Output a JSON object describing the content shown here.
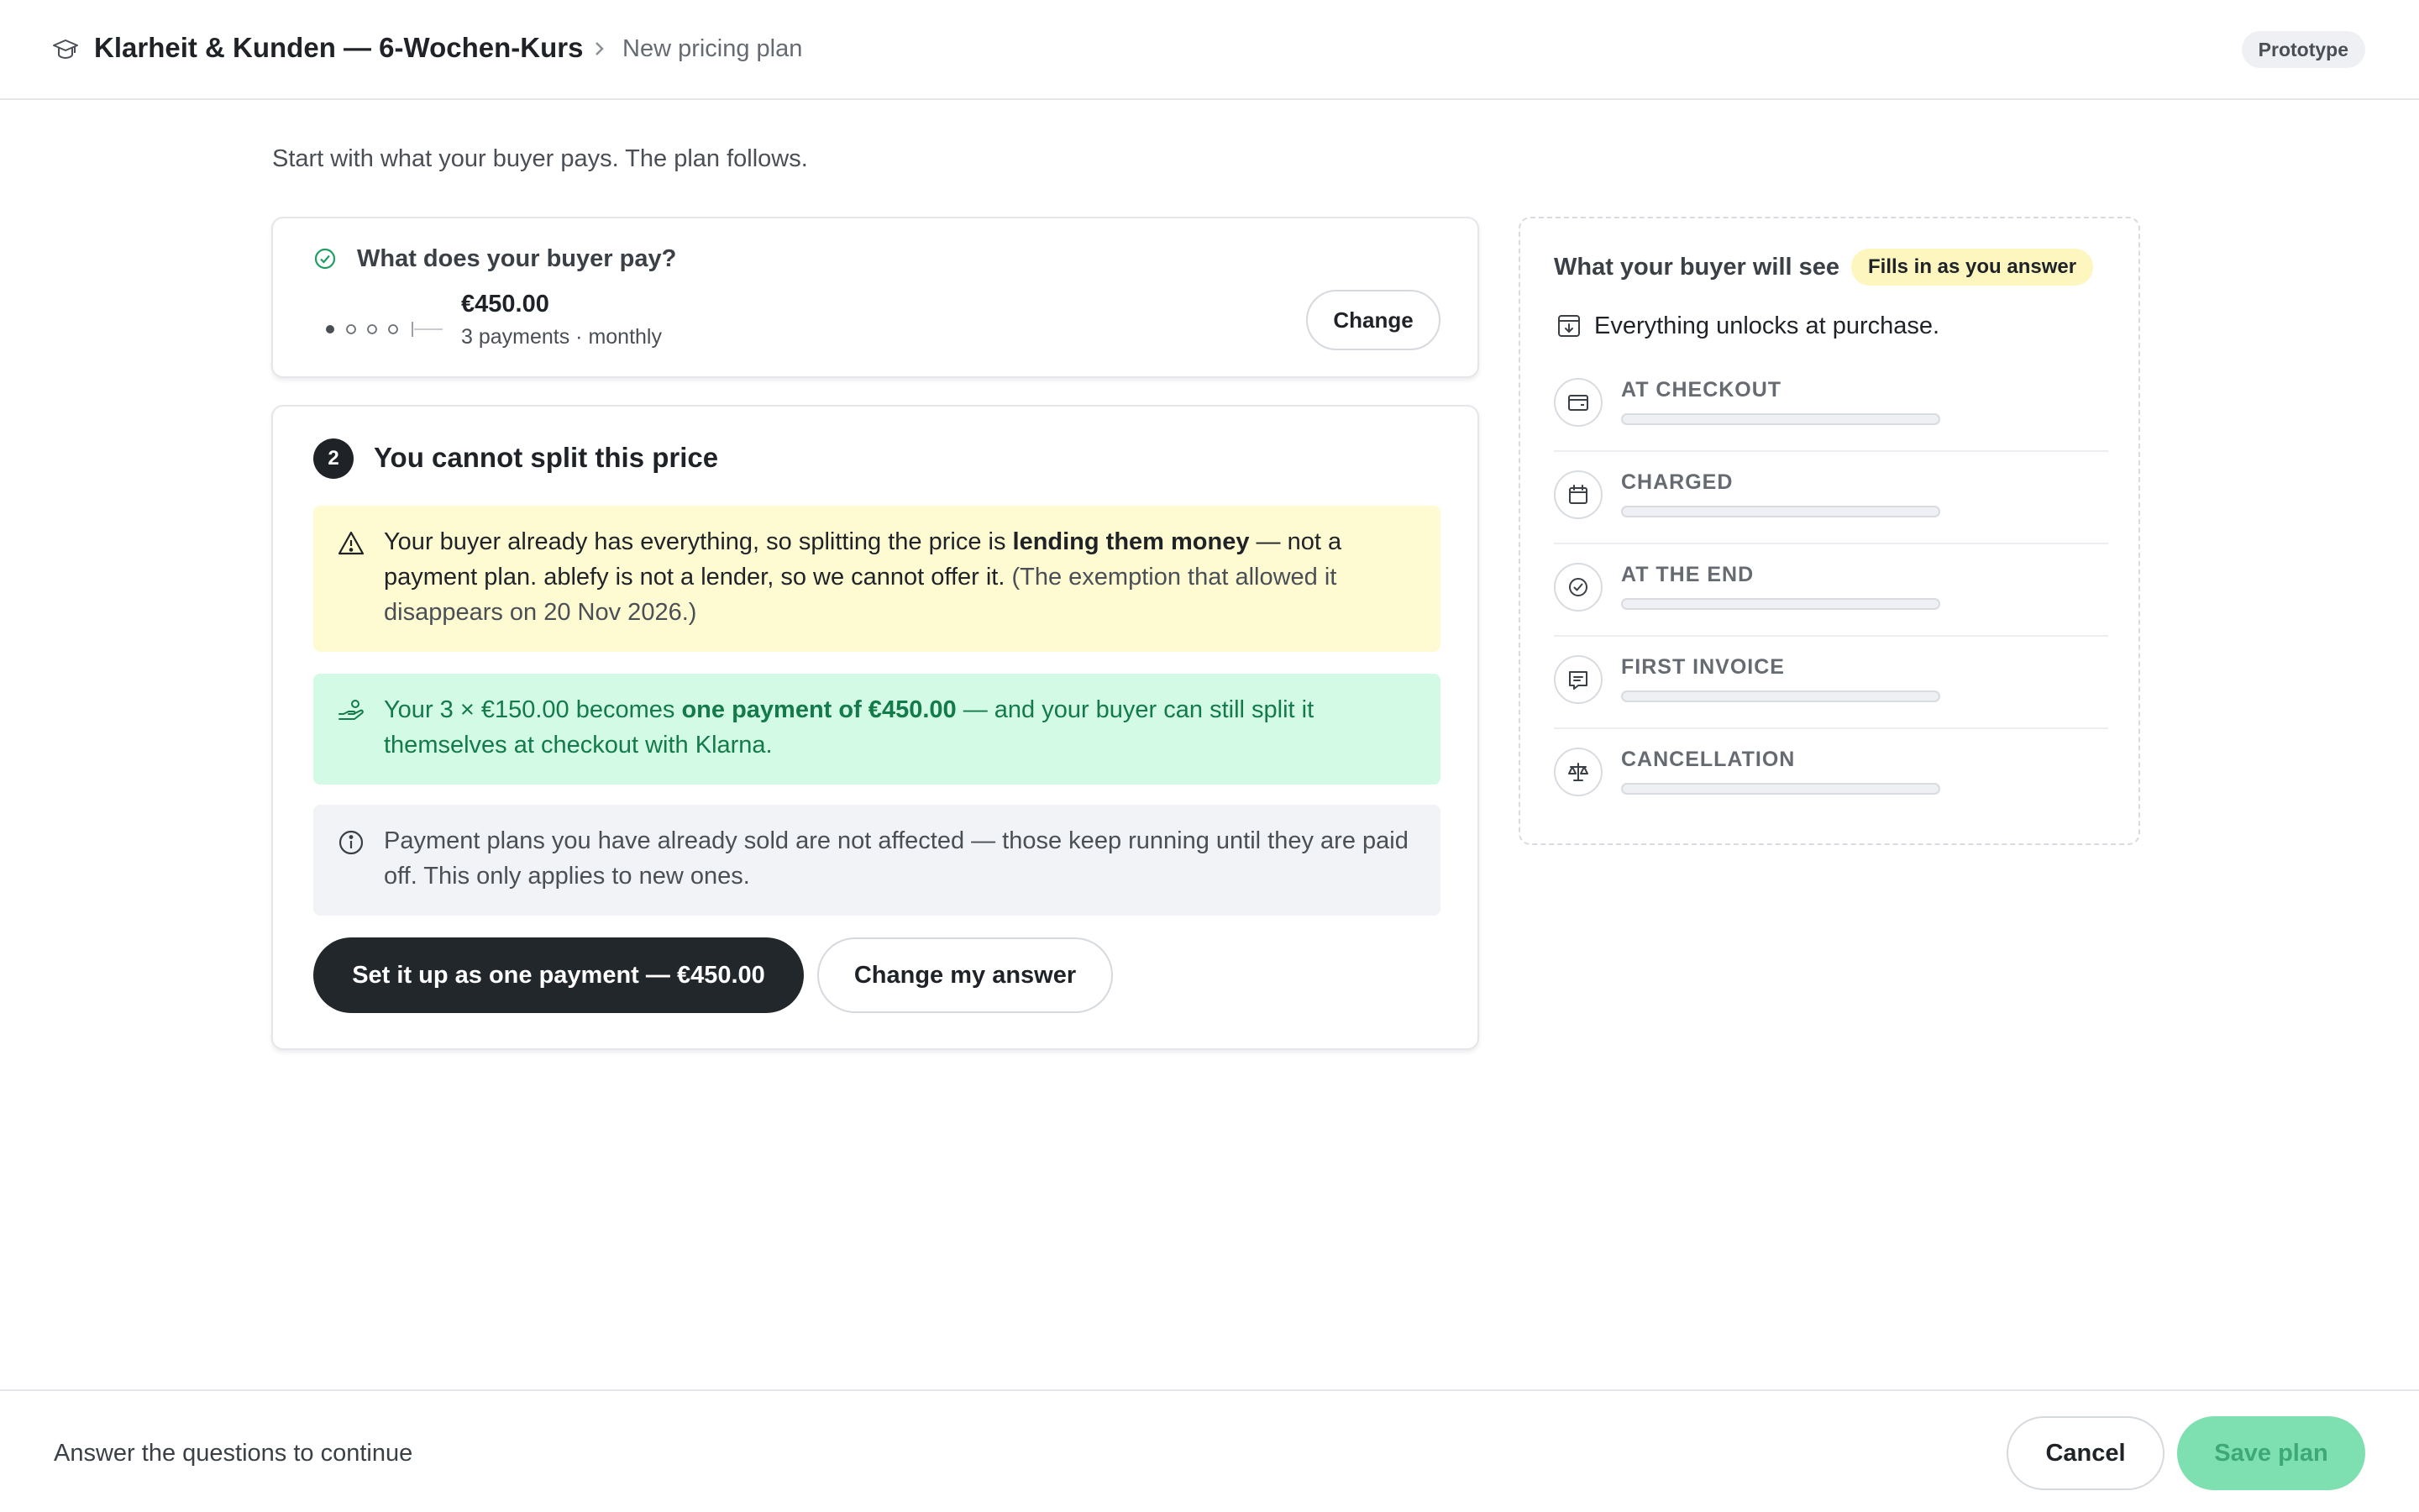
{
  "header": {
    "title": "Klarheit & Kunden — 6-Wochen-Kurs",
    "subtitle": "New pricing plan",
    "badge": "Prototype",
    "icon": "graduation-cap-icon"
  },
  "intro": "Start with what your buyer pays. The plan follows.",
  "question_card": {
    "question": "What does your buyer pay?",
    "price": "€450.00",
    "schedule": "3 payments · monthly",
    "change_label": "Change"
  },
  "step_card": {
    "step_number": "2",
    "title": "You cannot split this price",
    "warning": {
      "part1": "Your buyer already has everything, so splitting the price is ",
      "bold": "lending them money",
      "part2": " — not a payment plan. ablefy is not a lender, so we cannot offer it.",
      "muted": " (The exemption that allowed it disappears on 20 Nov 2026.)"
    },
    "success": {
      "part1": "Your 3 × €150.00 becomes ",
      "bold": "one payment of €450.00",
      "part2": " — and your buyer can still split it themselves at checkout with Klarna."
    },
    "info": "Payment plans you have already sold are not affected — those keep running until they are paid off. This only applies to new ones.",
    "primary_button": "Set it up as one payment — €450.00",
    "secondary_button": "Change my answer"
  },
  "preview": {
    "title": "What your buyer will see",
    "badge": "Fills in as you answer",
    "unlock_text": "Everything unlocks at purchase.",
    "rows": [
      {
        "label": "AT CHECKOUT",
        "icon": "wallet-icon"
      },
      {
        "label": "CHARGED",
        "icon": "calendar-icon"
      },
      {
        "label": "AT THE END",
        "icon": "check-circle-icon"
      },
      {
        "label": "FIRST INVOICE",
        "icon": "invoice-icon"
      },
      {
        "label": "CANCELLATION",
        "icon": "scales-icon"
      }
    ]
  },
  "footer": {
    "status": "Answer the questions to continue",
    "cancel": "Cancel",
    "save": "Save plan"
  },
  "colors": {
    "warning_bg": "#fefbd2",
    "success_bg": "#d2fae5",
    "success_text": "#137a4a",
    "info_bg": "#f2f3f6",
    "primary": "#22272c",
    "save_disabled": "#7ee0b0"
  }
}
